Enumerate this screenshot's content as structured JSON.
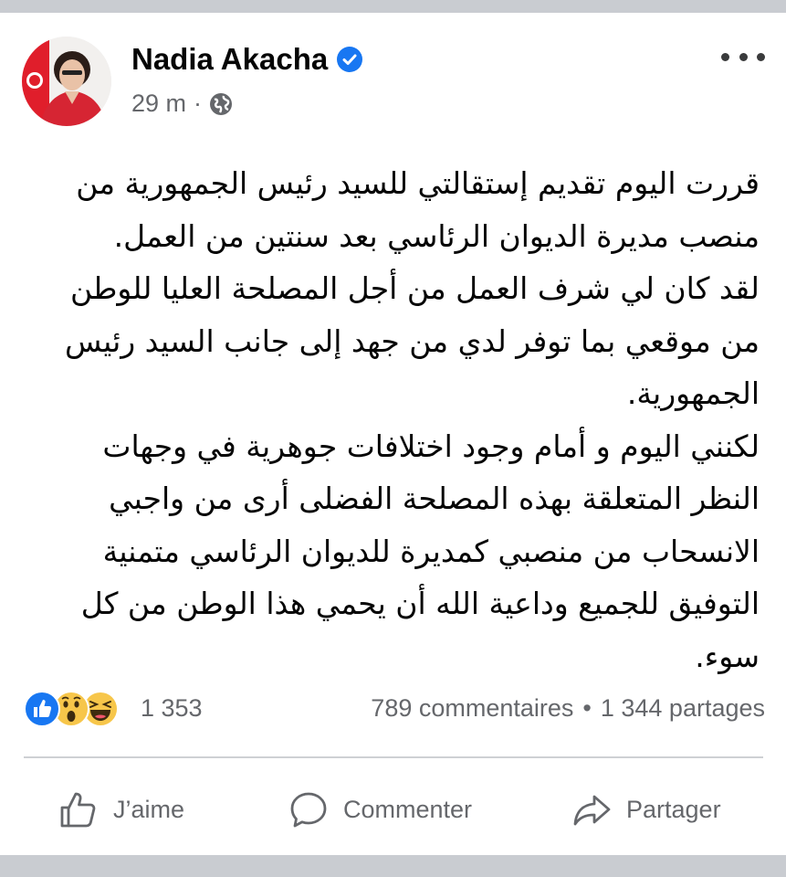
{
  "post": {
    "author": "Nadia Akacha",
    "timestamp": "29 m",
    "dot": "·",
    "visibility_icon": "globe-icon",
    "paragraphs": [
      "قررت اليوم تقديم إستقالتي للسيد رئيس الجمهورية من منصب مديرة الديوان الرئاسي بعد سنتين من العمل.",
      "لقد كان لي شرف العمل من أجل المصلحة العليا للوطن من موقعي بما توفر لدي من جهد  إلى جانب السيد رئيس الجمهورية.",
      "لكنني اليوم و أمام وجود اختلافات جوهرية في وجهات النظر المتعلقة بهذه المصلحة الفضلى أرى من واجبي الانسحاب من منصبي كمديرة للديوان الرئاسي متمنية التوفيق للجميع وداعية الله أن يحمي هذا الوطن من كل سوء."
    ]
  },
  "stats": {
    "reactions_count": "1 353",
    "comments": "789 commentaires",
    "separator": "•",
    "shares": "1 344 partages"
  },
  "actions": {
    "like": "J’aime",
    "comment": "Commenter",
    "share": "Partager"
  },
  "colors": {
    "facebook_blue": "#1877f2",
    "secondary_text": "#65676b",
    "divider": "#ced0d4"
  }
}
